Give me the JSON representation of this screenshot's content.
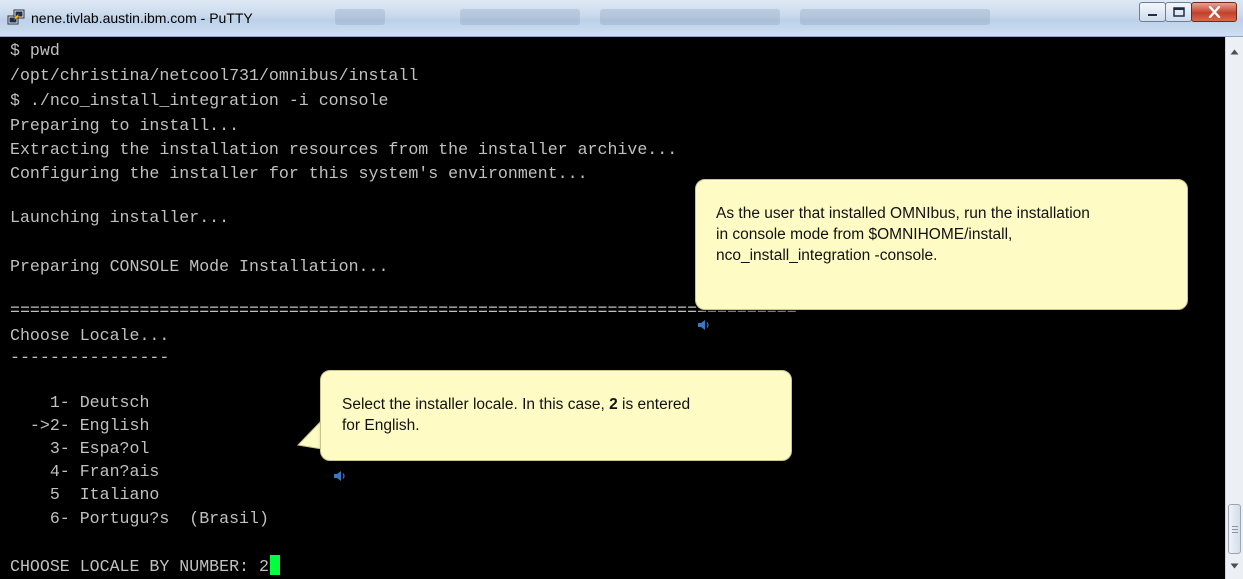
{
  "window": {
    "title": "nene.tivlab.austin.ibm.com - PuTTY",
    "icon": "putty-icon",
    "controls": [
      "minimize-icon",
      "maximize-icon",
      "close-icon"
    ]
  },
  "terminal": {
    "lines": [
      "$ pwd",
      "/opt/christina/netcool731/omnibus/install",
      "$ ./nco_install_integration -i console",
      "Preparing to install...",
      "Extracting the installation resources from the installer archive...",
      "Configuring the installer for this system's environment...",
      "",
      "Launching installer...",
      "",
      "Preparing CONSOLE Mode Installation...",
      "",
      "===============================================================================",
      "Choose Locale...",
      "----------------",
      "",
      "",
      "    1- Deutsch",
      "  ->2- English",
      "    3- Espa?ol",
      "    4- Fran?ais",
      "    5  Italiano",
      "    6- Portugu?s  (Brasil)",
      "",
      "CHOOSE LOCALE BY NUMBER: 2"
    ],
    "cursor_color": "#00ff3c",
    "text_color": "#c0c0c0"
  },
  "callouts": {
    "top": {
      "line1": "As the user that installed OMNIbus, run the installation",
      "line2": "in console mode from $OMNIHOME/install,",
      "line3": "nco_install_integration -console."
    },
    "bottom": {
      "line1_pre": "Select the installer locale. In this case, ",
      "line1_bold": "2",
      "line1_post": " is entered",
      "line2": "for English."
    },
    "audio_icon": "speaker-icon"
  },
  "colors": {
    "callout_fill": "#fefcc4",
    "terminal_bg": "#000000"
  }
}
